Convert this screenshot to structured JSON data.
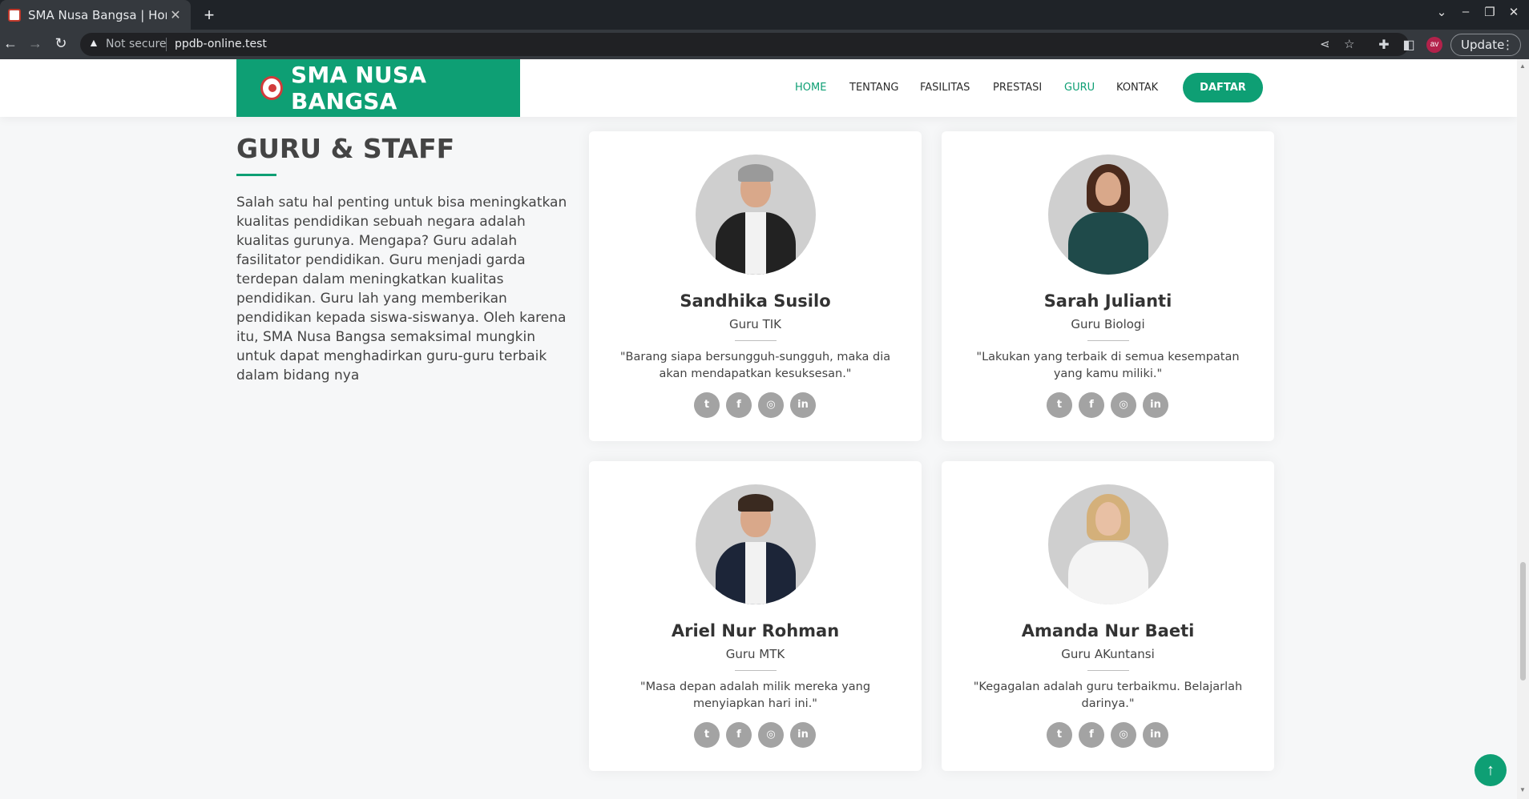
{
  "browser": {
    "tab_title": "SMA Nusa Bangsa | Home",
    "tab_close": "✕",
    "new_tab": "+",
    "security_label": "Not secure",
    "url": "ppdb-online.test",
    "update_label": "Update",
    "avatar_initials": "av",
    "icons": [
      "back-icon",
      "forward-icon",
      "reload-icon",
      "warning-icon",
      "share-icon",
      "star-icon",
      "extensions-icon",
      "sidepanel-icon",
      "menu-icon"
    ]
  },
  "site": {
    "logo_text": "SMA NUSA BANGSA",
    "nav": {
      "home": "HOME",
      "tentang": "TENTANG",
      "fasilitas": "FASILITAS",
      "prestasi": "PRESTASI",
      "guru": "GURU",
      "kontak": "KONTAK"
    },
    "daftar_label": "DAFTAR",
    "active_nav": [
      "HOME",
      "GURU"
    ],
    "accent_color": "#0e9f74"
  },
  "section": {
    "title": "GURU & STAFF",
    "description": "Salah satu hal penting untuk bisa meningkatkan kualitas pendidikan sebuah negara adalah kualitas gurunya. Mengapa? Guru adalah fasilitator pendidikan. Guru menjadi garda terdepan dalam meningkatkan kualitas pendidikan. Guru lah yang memberikan pendidikan kepada siswa-siswanya. Oleh karena itu, SMA Nusa Bangsa semaksimal mungkin untuk dapat menghadirkan guru-guru terbaik dalam bidang nya"
  },
  "teachers": [
    {
      "name": "Sandhika Susilo",
      "role": "Guru TIK",
      "quote": "\"Barang siapa bersungguh-sungguh, maka dia akan mendapatkan kesuksesan.\""
    },
    {
      "name": "Sarah Julianti",
      "role": "Guru Biologi",
      "quote": "\"Lakukan yang terbaik di semua kesempatan yang kamu miliki.\""
    },
    {
      "name": "Ariel Nur Rohman",
      "role": "Guru MTK",
      "quote": "\"Masa depan adalah milik mereka yang menyiapkan hari ini.\""
    },
    {
      "name": "Amanda Nur Baeti",
      "role": "Guru AKuntansi",
      "quote": "\"Kegagalan adalah guru terbaikmu. Belajarlah darinya.\""
    }
  ],
  "social_icons": {
    "twitter": "t",
    "facebook": "f",
    "instagram": "◎",
    "linkedin": "in"
  }
}
